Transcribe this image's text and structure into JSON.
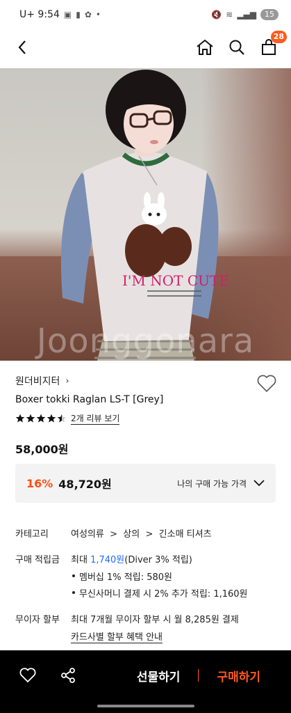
{
  "status_bar": {
    "carrier_time": "U+ 9:54",
    "battery": "15"
  },
  "nav": {
    "cart_count": "28"
  },
  "hero": {
    "watermark": "Joonggonara"
  },
  "product": {
    "brand": "원더비지터",
    "name": "Boxer tokki Raglan LS-T [Grey]",
    "rating": 4.5,
    "review_link": "2개 리뷰 보기",
    "price": "58,000원"
  },
  "discount": {
    "percent": "16%",
    "price": "48,720원",
    "my_price_label": "나의 구매 가능 가격"
  },
  "details": {
    "category_label": "카테고리",
    "category_path": [
      "여성의류",
      "상의",
      "긴소매 티셔츠"
    ],
    "points_label": "구매 적립금",
    "points_prefix": "최대 ",
    "points_value": "1,740원",
    "points_suffix": "(Diver 3% 적립)",
    "points_items": [
      "멤버십 1% 적립: 580원",
      "무신사머니 결제 시 2% 추가 적립: 1,160원"
    ],
    "installment_label": "무이자 할부",
    "installment_text": "최대 7개월 무이자 할부 시 월 8,285원 결제",
    "installment_link": "카드사별 할부 혜택 안내"
  },
  "bottom_bar": {
    "gift_label": "선물하기",
    "buy_label": "구매하기"
  },
  "colors": {
    "accent": "#ff5a1f",
    "discount": "#ff4d12",
    "link_blue": "#1f6bff"
  }
}
